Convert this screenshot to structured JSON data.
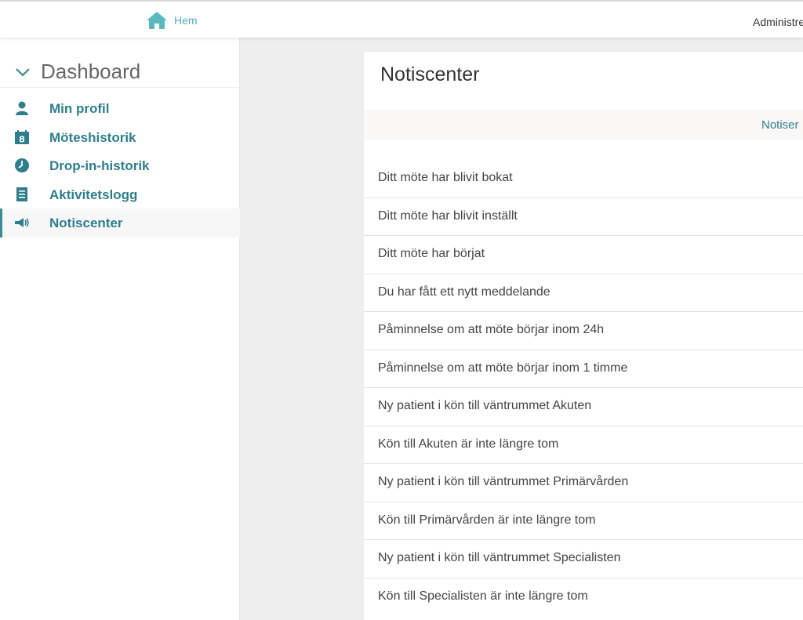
{
  "topbar": {
    "home_label": "Hem",
    "home_icon": "home-icon",
    "admin_label": "Administre",
    "accent_color": "#4fb0b8"
  },
  "sidebar": {
    "title": "Dashboard",
    "collapse_icon": "chevron-down-icon",
    "items": [
      {
        "label": "Min profil",
        "icon": "user-icon",
        "active": false
      },
      {
        "label": "Möteshistorik",
        "icon": "calendar-icon",
        "active": false
      },
      {
        "label": "Drop-in-historik",
        "icon": "clock-icon",
        "active": false
      },
      {
        "label": "Aktivitetslogg",
        "icon": "document-icon",
        "active": false
      },
      {
        "label": "Notiscenter",
        "icon": "megaphone-icon",
        "active": true
      }
    ],
    "link_color": "#2f7e8c"
  },
  "main": {
    "title": "Notiscenter",
    "subbar_label": "Notiser",
    "notifications": [
      "Ditt möte har blivit bokat",
      "Ditt möte har blivit inställt",
      "Ditt möte har börjat",
      "Du har fått ett nytt meddelande",
      "Påminnelse om att möte börjar inom 24h",
      "Påminnelse om att möte börjar inom 1 timme",
      "Ny patient i kön till väntrummet Akuten",
      "Kön till Akuten är inte längre tom",
      "Ny patient i kön till väntrummet Primärvården",
      "Kön till Primärvården är inte längre tom",
      "Ny patient i kön till väntrummet Specialisten",
      "Kön till Specialisten är inte längre tom"
    ]
  }
}
